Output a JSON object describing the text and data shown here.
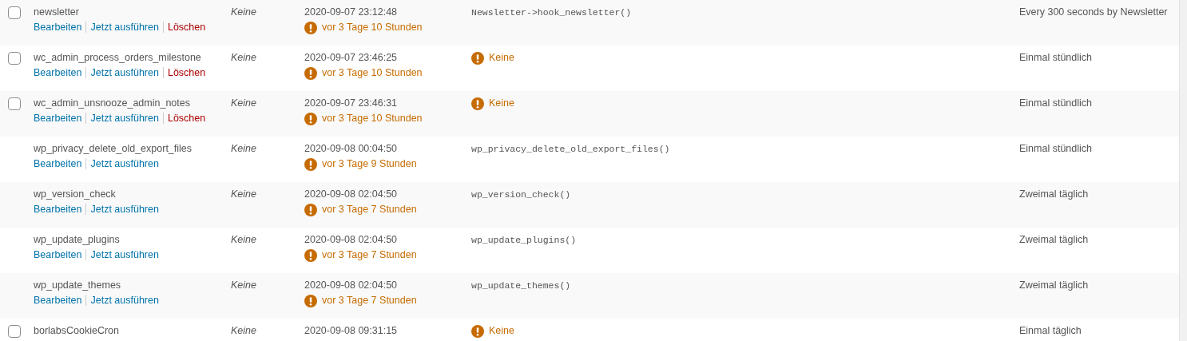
{
  "rows": [
    {
      "checkbox": {
        "checked": false
      },
      "hook": "newsletter",
      "links": [
        {
          "kind": "edit",
          "label": "Bearbeiten"
        },
        {
          "kind": "run",
          "label": "Jetzt ausführen"
        },
        {
          "kind": "delete",
          "label": "Löschen"
        }
      ],
      "arguments": "Keine",
      "next_run": "2020-09-07 23:12:48",
      "overdue": "vor 3 Tage 10 Stunden",
      "action": {
        "kind": "code",
        "text": "Newsletter->hook_newsletter()"
      },
      "recurrence": "Every 300 seconds by Newsletter"
    },
    {
      "checkbox": {
        "checked": false
      },
      "hook": "wc_admin_process_orders_milestone",
      "links": [
        {
          "kind": "edit",
          "label": "Bearbeiten"
        },
        {
          "kind": "run",
          "label": "Jetzt ausführen"
        },
        {
          "kind": "delete",
          "label": "Löschen"
        }
      ],
      "arguments": "Keine",
      "next_run": "2020-09-07 23:46:25",
      "overdue": "vor 3 Tage 10 Stunden",
      "action": {
        "kind": "warning",
        "text": "Keine"
      },
      "recurrence": "Einmal stündlich"
    },
    {
      "checkbox": {
        "checked": false
      },
      "hook": "wc_admin_unsnooze_admin_notes",
      "links": [
        {
          "kind": "edit",
          "label": "Bearbeiten"
        },
        {
          "kind": "run",
          "label": "Jetzt ausführen"
        },
        {
          "kind": "delete",
          "label": "Löschen"
        }
      ],
      "arguments": "Keine",
      "next_run": "2020-09-07 23:46:31",
      "overdue": "vor 3 Tage 10 Stunden",
      "action": {
        "kind": "warning",
        "text": "Keine"
      },
      "recurrence": "Einmal stündlich"
    },
    {
      "hook": "wp_privacy_delete_old_export_files",
      "links": [
        {
          "kind": "edit",
          "label": "Bearbeiten"
        },
        {
          "kind": "run",
          "label": "Jetzt ausführen"
        }
      ],
      "arguments": "Keine",
      "next_run": "2020-09-08 00:04:50",
      "overdue": "vor 3 Tage 9 Stunden",
      "action": {
        "kind": "code",
        "text": "wp_privacy_delete_old_export_files()"
      },
      "recurrence": "Einmal stündlich"
    },
    {
      "hook": "wp_version_check",
      "links": [
        {
          "kind": "edit",
          "label": "Bearbeiten"
        },
        {
          "kind": "run",
          "label": "Jetzt ausführen"
        }
      ],
      "arguments": "Keine",
      "next_run": "2020-09-08 02:04:50",
      "overdue": "vor 3 Tage 7 Stunden",
      "action": {
        "kind": "code",
        "text": "wp_version_check()"
      },
      "recurrence": "Zweimal täglich"
    },
    {
      "hook": "wp_update_plugins",
      "links": [
        {
          "kind": "edit",
          "label": "Bearbeiten"
        },
        {
          "kind": "run",
          "label": "Jetzt ausführen"
        }
      ],
      "arguments": "Keine",
      "next_run": "2020-09-08 02:04:50",
      "overdue": "vor 3 Tage 7 Stunden",
      "action": {
        "kind": "code",
        "text": "wp_update_plugins()"
      },
      "recurrence": "Zweimal täglich"
    },
    {
      "hook": "wp_update_themes",
      "links": [
        {
          "kind": "edit",
          "label": "Bearbeiten"
        },
        {
          "kind": "run",
          "label": "Jetzt ausführen"
        }
      ],
      "arguments": "Keine",
      "next_run": "2020-09-08 02:04:50",
      "overdue": "vor 3 Tage 7 Stunden",
      "action": {
        "kind": "code",
        "text": "wp_update_themes()"
      },
      "recurrence": "Zweimal täglich"
    },
    {
      "checkbox": {
        "checked": false
      },
      "hook": "borlabsCookieCron",
      "links": [],
      "arguments": "Keine",
      "next_run": "2020-09-08 09:31:15",
      "action": {
        "kind": "warning",
        "text": "Keine"
      },
      "recurrence": "Einmal täglich"
    }
  ]
}
